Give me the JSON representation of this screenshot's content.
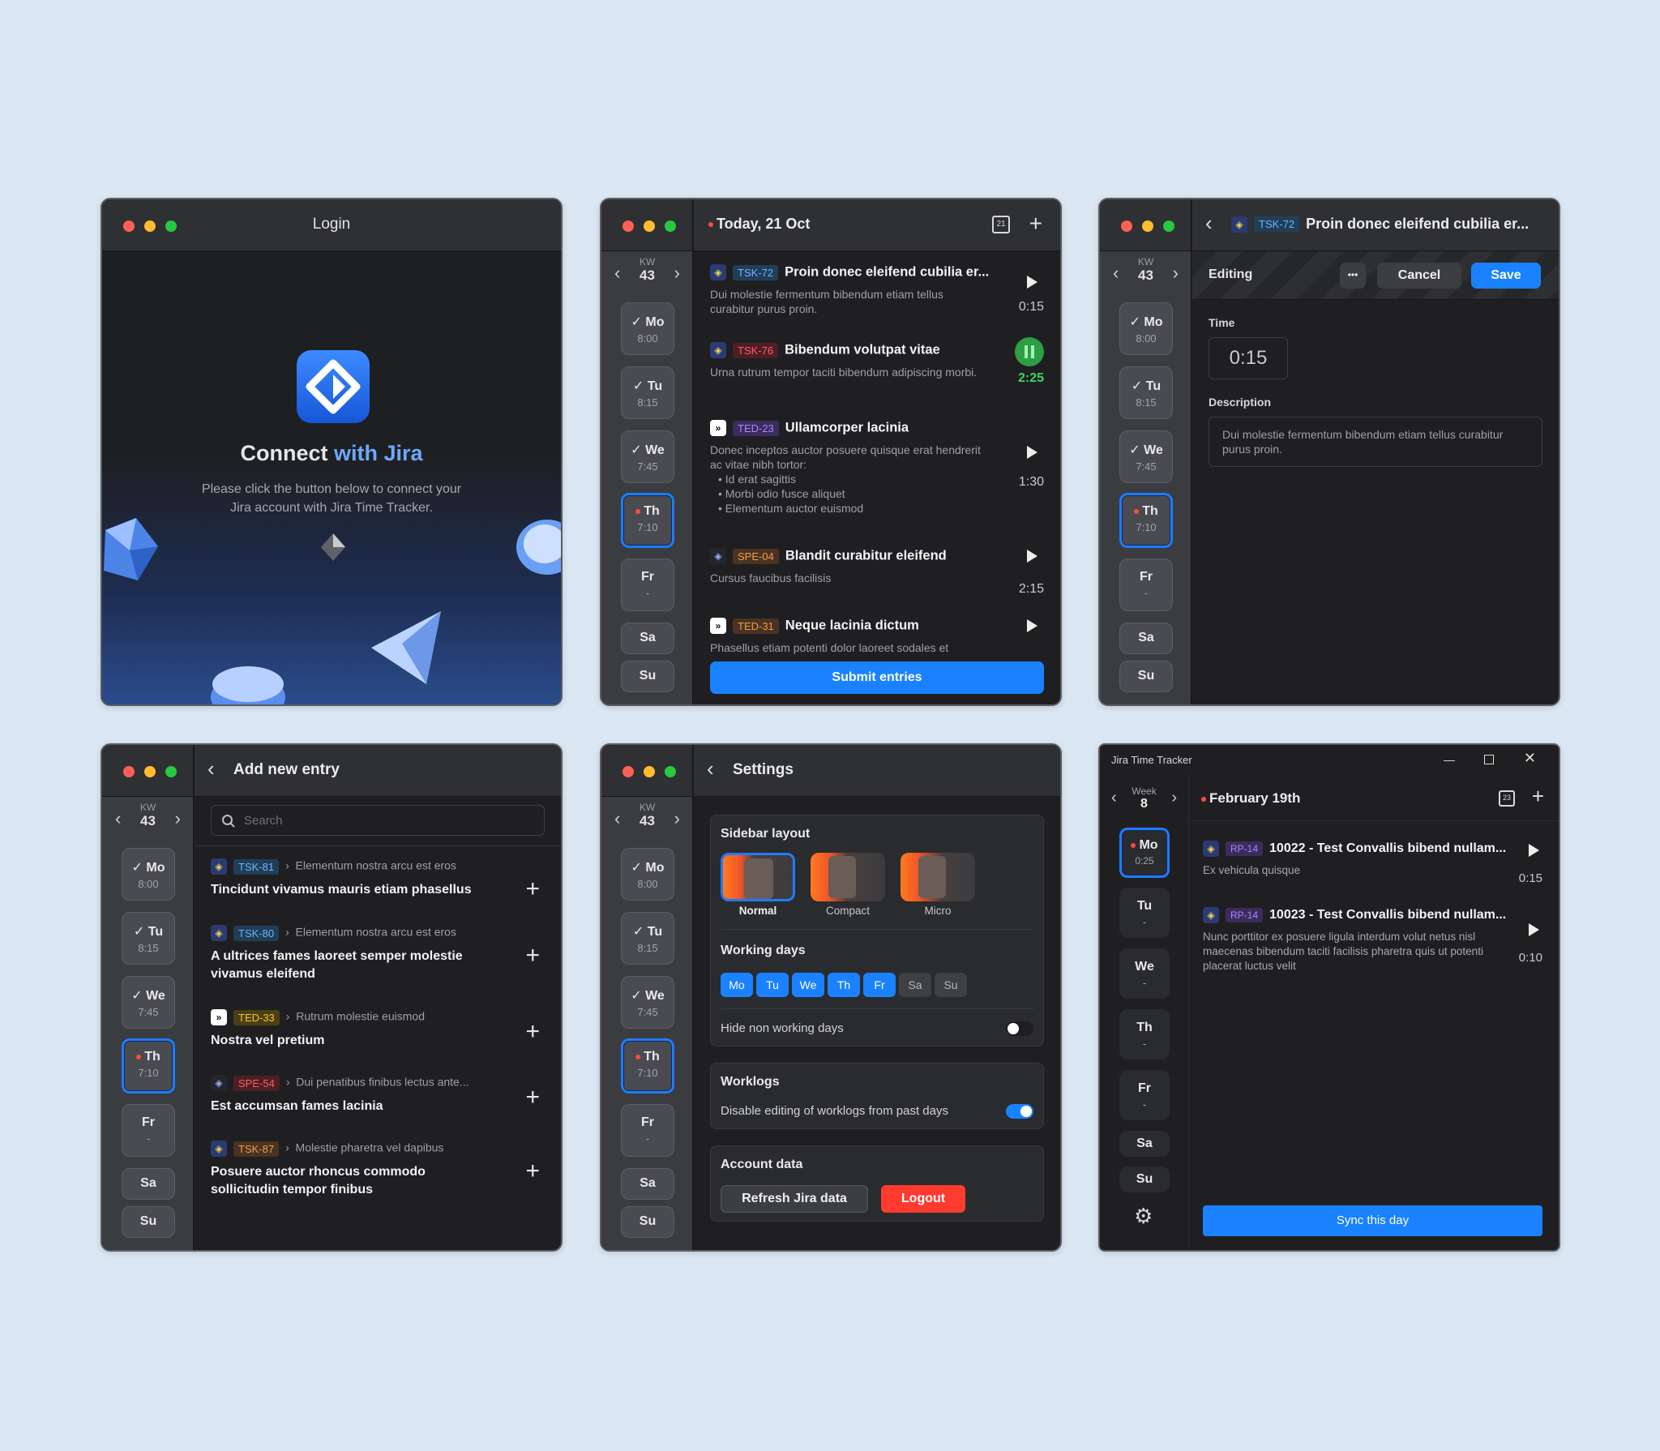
{
  "login": {
    "title": "Login",
    "heading_a": "Connect ",
    "heading_b": "with Jira",
    "text_1": "Please click the button below to connect your",
    "text_2": "Jira account with Jira Time Tracker."
  },
  "week": {
    "kw": "KW",
    "num": "43",
    "days": [
      {
        "d": "Mo",
        "h": "8:00"
      },
      {
        "d": "Tu",
        "h": "8:15"
      },
      {
        "d": "We",
        "h": "7:45"
      },
      {
        "d": "Th",
        "h": "7:10"
      },
      {
        "d": "Fr",
        "h": "-"
      },
      {
        "d": "Sa"
      },
      {
        "d": "Su"
      }
    ]
  },
  "today": {
    "title": "Today, 21 Oct",
    "submit": "Submit entries",
    "entries": [
      {
        "key": "TSK-72",
        "title": "Proin donec eleifend cubilia er...",
        "desc": "Dui molestie fermentum bibendum etiam tellus curabitur purus proin.",
        "dur": "0:15"
      },
      {
        "key": "TSK-76",
        "title": "Bibendum volutpat vitae",
        "desc": "Urna rutrum tempor taciti bibendum adipiscing morbi.",
        "dur": "2:25"
      },
      {
        "key": "TED-23",
        "title": "Ullamcorper lacinia",
        "desc": "Donec inceptos auctor posuere quisque erat hendrerit ac vitae nibh tortor:",
        "bullets": [
          "Id erat sagittis",
          "Morbi odio fusce aliquet",
          "Elementum auctor euismod"
        ],
        "dur": "1:30"
      },
      {
        "key": "SPE-04",
        "title": "Blandit curabitur eleifend",
        "desc": "Cursus faucibus facilisis",
        "dur": "2:15"
      },
      {
        "key": "TED-31",
        "title": "Neque lacinia dictum",
        "desc": "Phasellus etiam potenti dolor laoreet sodales et"
      }
    ]
  },
  "edit": {
    "key": "TSK-72",
    "title": "Proin donec eleifend cubilia er...",
    "mode": "Editing",
    "more": "•••",
    "cancel": "Cancel",
    "save": "Save",
    "time_label": "Time",
    "time": "0:15",
    "desc_label": "Description",
    "desc": "Dui molestie fermentum bibendum etiam tellus curabitur purus proin."
  },
  "add": {
    "title": "Add new entry",
    "search_ph": "Search",
    "items": [
      {
        "key": "TSK-81",
        "parent": "Elementum nostra arcu est eros",
        "title": "Tincidunt vivamus mauris etiam phasellus"
      },
      {
        "key": "TSK-80",
        "parent": "Elementum nostra arcu est eros",
        "title": "A ultrices fames laoreet semper molestie vivamus eleifend"
      },
      {
        "key": "TED-33",
        "parent": "Rutrum molestie euismod",
        "title": "Nostra vel pretium"
      },
      {
        "key": "SPE-54",
        "parent": "Dui penatibus finibus lectus ante...",
        "title": "Est accumsan fames lacinia"
      },
      {
        "key": "TSK-87",
        "parent": "Molestie pharetra vel dapibus",
        "title": "Posuere auctor rhoncus commodo sollicitudin tempor finibus"
      }
    ]
  },
  "settings": {
    "title": "Settings",
    "sidebar_layout": "Sidebar layout",
    "layouts": [
      "Normal",
      "Compact",
      "Micro"
    ],
    "working_days": "Working days",
    "wd": [
      "Mo",
      "Tu",
      "We",
      "Th",
      "Fr",
      "Sa",
      "Su"
    ],
    "hide": "Hide non working days",
    "worklogs": "Worklogs",
    "disable": "Disable editing of worklogs from past days",
    "account": "Account data",
    "refresh": "Refresh Jira data",
    "logout": "Logout"
  },
  "win": {
    "app": "Jira Time Tracker",
    "week": "Week",
    "week_num": "8",
    "date": "February 19th",
    "days": [
      {
        "d": "Mo",
        "h": "0:25"
      },
      {
        "d": "Tu",
        "h": "-"
      },
      {
        "d": "We",
        "h": "-"
      },
      {
        "d": "Th",
        "h": "-"
      },
      {
        "d": "Fr",
        "h": "-"
      },
      {
        "d": "Sa"
      },
      {
        "d": "Su"
      }
    ],
    "entries": [
      {
        "key": "RP-14",
        "title": "10022 - Test Convallis bibend nullam...",
        "desc": "Ex vehicula quisque",
        "dur": "0:15"
      },
      {
        "key": "RP-14",
        "title": "10023 - Test Convallis bibend nullam...",
        "desc": "Nunc porttitor ex posuere ligula interdum volut netus nisl maecenas bibendum taciti facilisis pharetra quis ut potenti placerat luctus velit",
        "dur": "0:10"
      }
    ],
    "sync": "Sync this day"
  },
  "colors": {
    "accent": "#1a82ff",
    "bg": "#dbe7f3",
    "panel": "#1f1f21",
    "logout": "#ff3b30",
    "playing": "#30c742"
  }
}
